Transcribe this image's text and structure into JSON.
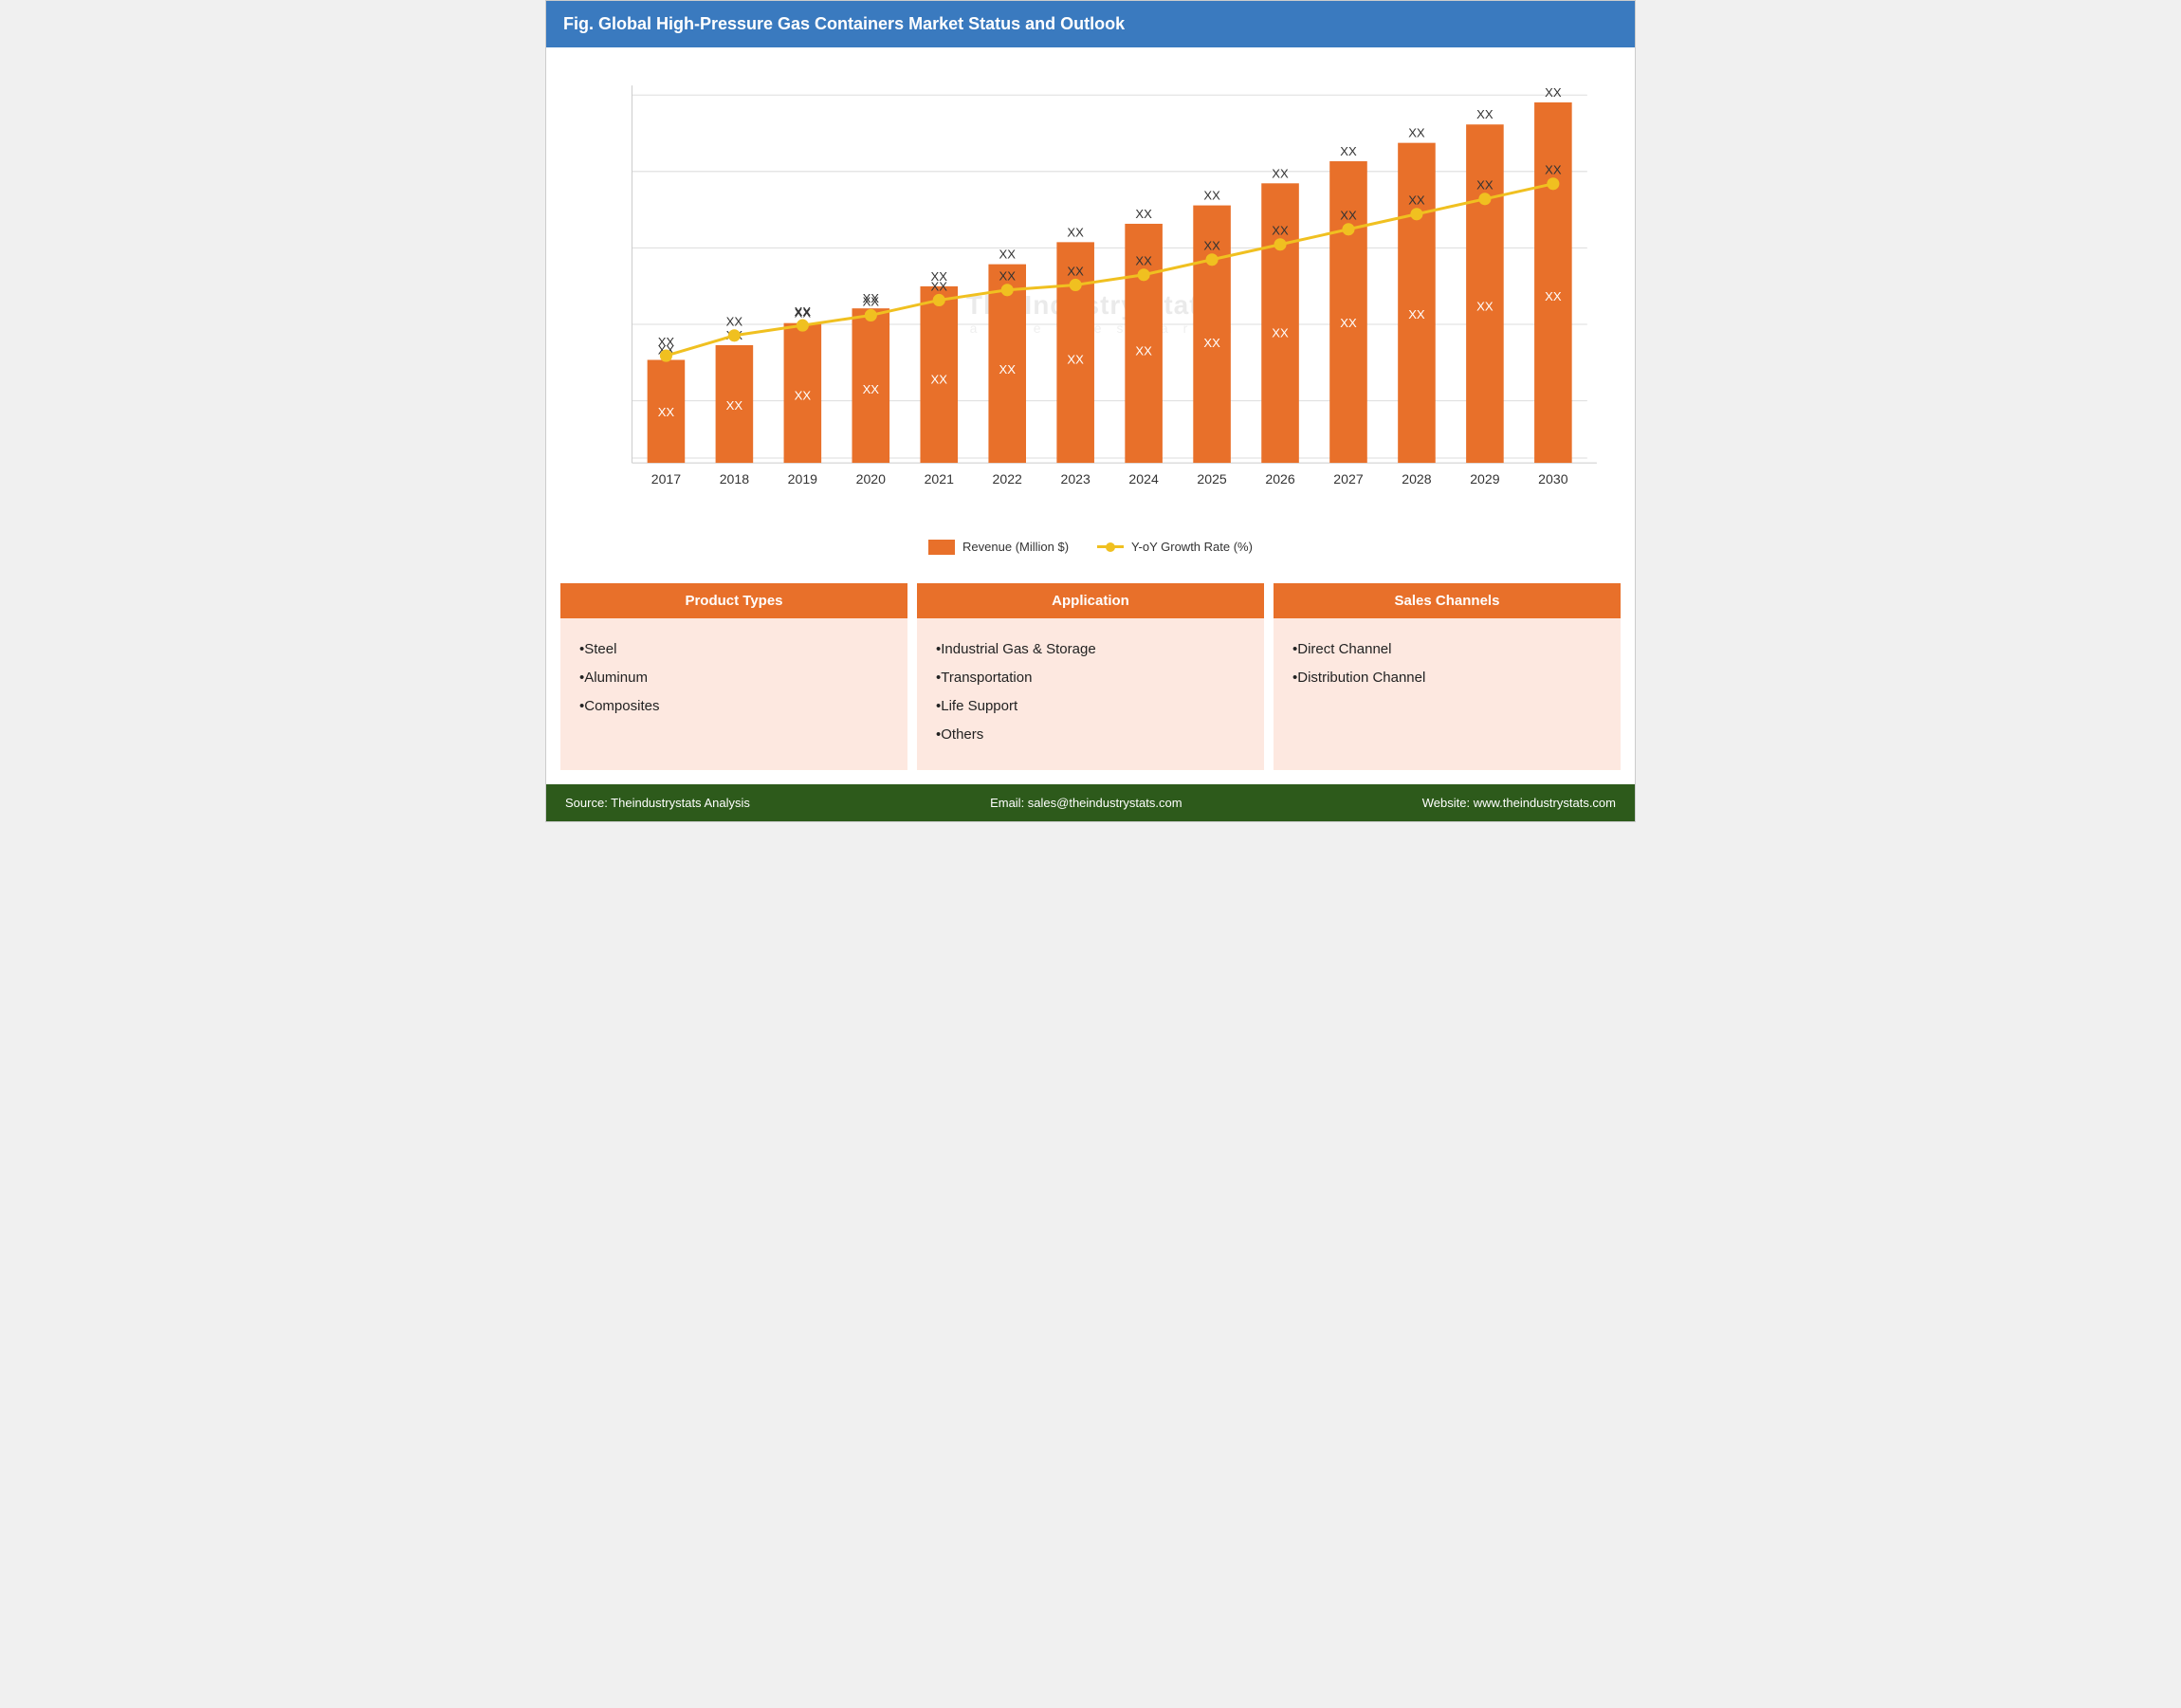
{
  "header": {
    "title": "Fig. Global High-Pressure Gas Containers Market Status and Outlook"
  },
  "chart": {
    "years": [
      "2017",
      "2018",
      "2019",
      "2020",
      "2021",
      "2022",
      "2023",
      "2024",
      "2025",
      "2026",
      "2027",
      "2028",
      "2029",
      "2030"
    ],
    "bar_heights": [
      0.28,
      0.32,
      0.38,
      0.42,
      0.48,
      0.54,
      0.6,
      0.65,
      0.7,
      0.76,
      0.82,
      0.87,
      0.92,
      0.98
    ],
    "line_points": [
      0.38,
      0.42,
      0.44,
      0.46,
      0.49,
      0.51,
      0.52,
      0.54,
      0.57,
      0.6,
      0.63,
      0.66,
      0.69,
      0.72
    ],
    "bar_labels_top": [
      "XX",
      "XX",
      "XX",
      "XX",
      "XX",
      "XX",
      "XX",
      "XX",
      "XX",
      "XX",
      "XX",
      "XX",
      "XX",
      "XX"
    ],
    "bar_labels_mid": [
      "XX",
      "XX",
      "XX",
      "XX",
      "XX",
      "XX",
      "XX",
      "XX",
      "XX",
      "XX",
      "XX",
      "XX",
      "XX",
      "XX"
    ],
    "line_labels": [
      "XX",
      "XX",
      "XX",
      "XX",
      "XX",
      "XX",
      "XX",
      "XX",
      "XX",
      "XX",
      "XX",
      "XX",
      "XX",
      "XX"
    ],
    "legend": {
      "bar_label": "Revenue (Million $)",
      "line_label": "Y-oY Growth Rate (%)"
    }
  },
  "sections": [
    {
      "title": "Product Types",
      "items": [
        "Steel",
        "Aluminum",
        "Composites"
      ]
    },
    {
      "title": "Application",
      "items": [
        "Industrial Gas & Storage",
        "Transportation",
        "Life Support",
        "Others"
      ]
    },
    {
      "title": "Sales Channels",
      "items": [
        "Direct Channel",
        "Distribution Channel"
      ]
    }
  ],
  "footer": {
    "source": "Source: Theindustrystats Analysis",
    "email": "Email: sales@theindustrystats.com",
    "website": "Website: www.theindustrystats.com"
  },
  "watermark": {
    "title": "The Industry Stats",
    "sub": "m a r k e t   r e s e a r c h"
  }
}
